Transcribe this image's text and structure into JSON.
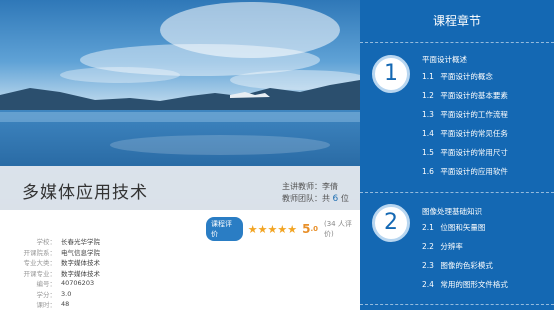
{
  "course": {
    "title": "多媒体应用技术",
    "teacher": "主讲教师：李倩",
    "team_prefix": "教师团队：共",
    "team_count": "6",
    "team_suffix": "位"
  },
  "rating": {
    "button_label": "课程评价",
    "stars": "★★★★★",
    "score_int": "5",
    "score_dec": ".0",
    "reviews": "(34 人评价)"
  },
  "info": [
    {
      "label": "学校：",
      "value": "长春光华学院"
    },
    {
      "label": "开课院系：",
      "value": "电气信息学院"
    },
    {
      "label": "专业大类：",
      "value": "数字媒体技术"
    },
    {
      "label": "开课专业：",
      "value": "数字媒体技术"
    },
    {
      "label": "编号：",
      "value": "40706203"
    },
    {
      "label": "学分：",
      "value": "3.0"
    },
    {
      "label": "课时：",
      "value": "48"
    }
  ],
  "chapters": {
    "header": "课程章节",
    "sections": [
      {
        "number": "1",
        "title": "平面设计概述",
        "items": [
          {
            "num": "1.1",
            "label": "平面设计的概念"
          },
          {
            "num": "1.2",
            "label": "平面设计的基本要素"
          },
          {
            "num": "1.3",
            "label": "平面设计的工作流程"
          },
          {
            "num": "1.4",
            "label": "平面设计的常见任务"
          },
          {
            "num": "1.5",
            "label": "平面设计的常用尺寸"
          },
          {
            "num": "1.6",
            "label": "平面设计的应用软件"
          }
        ]
      },
      {
        "number": "2",
        "title": "图像处理基础知识",
        "items": [
          {
            "num": "2.1",
            "label": "位图和矢量图"
          },
          {
            "num": "2.2",
            "label": "分辨率"
          },
          {
            "num": "2.3",
            "label": "图像的色彩模式"
          },
          {
            "num": "2.4",
            "label": "常用的图形文件格式"
          }
        ]
      }
    ]
  },
  "colors": {
    "panel_blue": "#1468b3",
    "star": "#f2a422",
    "score": "#e8902a",
    "button": "#2a7dc4"
  }
}
